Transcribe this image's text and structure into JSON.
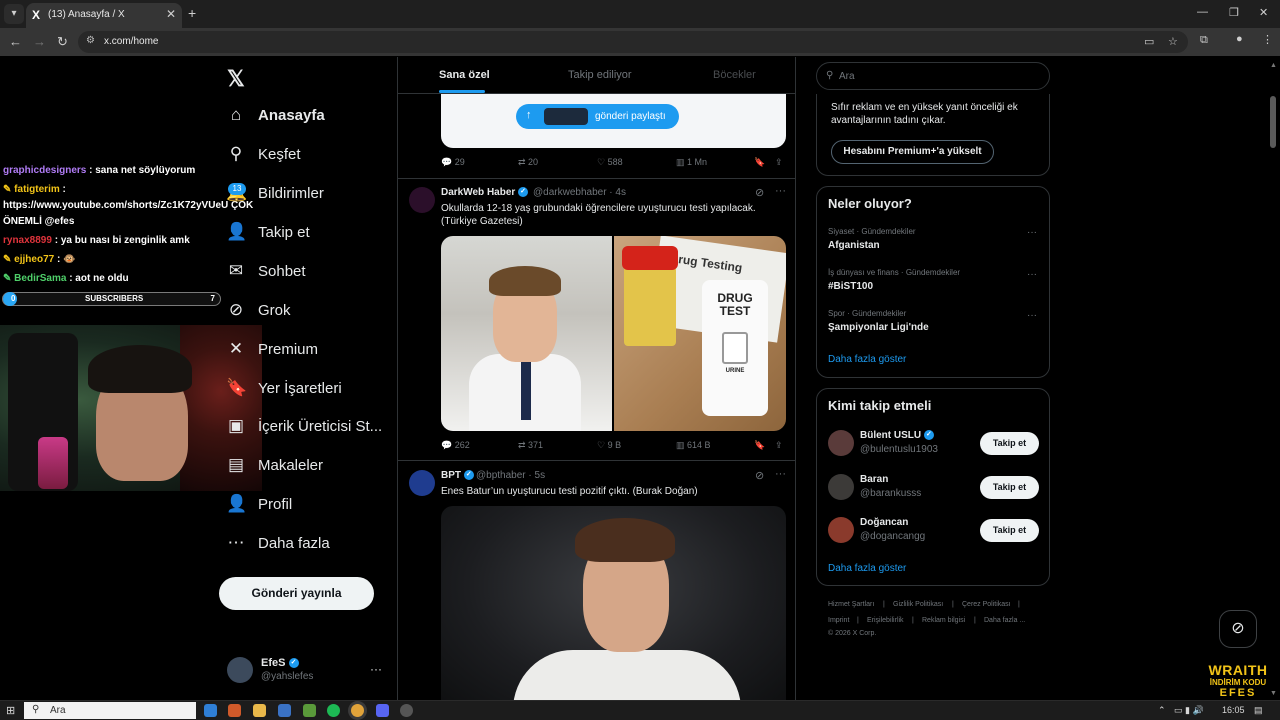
{
  "browser": {
    "tab_title": "(13) Anasayfa / X",
    "tab_favicon": "X",
    "url": "x.com/home"
  },
  "stream_overlay": {
    "chat": [
      {
        "user": "graphicdesigners",
        "message": " : sana net söylüyorum",
        "color": "#b07cf5"
      },
      {
        "user": "fatigterim",
        "message": " :",
        "color": "#f2c418"
      },
      {
        "user": "",
        "message": "https://www.youtube.com/shorts/Zc1K72yVUeU ÇOK",
        "color": "#ffffff"
      },
      {
        "user": "",
        "message": "ÖNEMLİ @efes",
        "color": "#ffffff"
      },
      {
        "user": "rynax8899",
        "message": " : ya bu nası bi zenginlik amk",
        "color": "#e0343c"
      },
      {
        "user": "ejjheo77",
        "message": " : 🐵",
        "color": "#f2c418"
      },
      {
        "user": "BedirSama",
        "message": " : aot ne oldu",
        "color": "#4fd06a"
      }
    ],
    "subscribers_label": "SUBSCRIBERS",
    "subscribers_current": "0",
    "subscribers_goal": "7",
    "brand_line1": "WRAITH",
    "brand_line2": "İNDİRİM KODU",
    "brand_line3": "EFES"
  },
  "x_nav": {
    "logo": "𝕏",
    "items": [
      {
        "label": "Anasayfa",
        "icon": "home-icon",
        "glyph": "⌂",
        "active": true
      },
      {
        "label": "Keşfet",
        "icon": "search-icon",
        "glyph": "⚲"
      },
      {
        "label": "Bildirimler",
        "icon": "bell-icon",
        "glyph": "🔔"
      },
      {
        "label": "Takip et",
        "icon": "person-add-icon",
        "glyph": "👤"
      },
      {
        "label": "Sohbet",
        "icon": "mail-icon",
        "glyph": "✉"
      },
      {
        "label": "Grok",
        "icon": "grok-icon",
        "glyph": "⊘"
      },
      {
        "label": "Premium",
        "icon": "premium-icon",
        "glyph": "✕"
      },
      {
        "label": "Yer İşaretleri",
        "icon": "bookmark-icon",
        "glyph": "🔖"
      },
      {
        "label": "İçerik Üreticisi St...",
        "icon": "creator-studio-icon",
        "glyph": "▣"
      },
      {
        "label": "Makaleler",
        "icon": "articles-icon",
        "glyph": "▤"
      },
      {
        "label": "Profil",
        "icon": "profile-icon",
        "glyph": "👤"
      },
      {
        "label": "Daha fazla",
        "icon": "more-circle-icon",
        "glyph": "⋯"
      }
    ],
    "notifications_badge": "13",
    "post_button": "Gönderi yayınla",
    "account": {
      "name": "EfeS",
      "handle": "@yahslefes"
    }
  },
  "timeline": {
    "tabs": [
      "Sana özel",
      "Takip ediliyor",
      "Böcekler"
    ],
    "top_post": {
      "share_pill": "gönderi paylaştı",
      "replies": "29",
      "reposts": "20",
      "likes": "588",
      "views": "1 Mn"
    },
    "posts": [
      {
        "author": "DarkWeb Haber",
        "handle": "@darkwebhaber",
        "time": "4s",
        "text": "Okullarda 12-18 yaş grubundaki öğrencilere uyuşturucu testi yapılacak. (Türkiye Gazetesi)",
        "image_left_alt": "schoolboy in classroom",
        "image_right_text": "Drug Testing",
        "kit_text": "DRUG TEST",
        "kit_label": "URINE",
        "replies": "262",
        "reposts": "371",
        "likes": "9 B",
        "views": "614 B"
      },
      {
        "author": "BPT",
        "handle": "@bpthaber",
        "time": "5s",
        "text": "Enes Batur’un uyuşturucu testi pozitif çıktı. (Burak Doğan)"
      }
    ]
  },
  "right": {
    "search_placeholder": "Ara",
    "premium_text": "Sıfır reklam ve en yüksek yanıt önceliği ek avantajlarının tadını çıkar.",
    "premium_button": "Hesabını Premium+'a yükselt",
    "trends_title": "Neler oluyor?",
    "trends": [
      {
        "category": "Siyaset · Gündemdekiler",
        "name": "Afganistan"
      },
      {
        "category": "İş dünyası ve finans · Gündemdekiler",
        "name": "#BiST100"
      },
      {
        "category": "Spor · Gündemdekiler",
        "name": "Şampiyonlar Ligi'nde"
      }
    ],
    "trends_more": "Daha fazla göster",
    "wtf_title": "Kimi takip etmeli",
    "wtf": [
      {
        "name": "Bülent USLU",
        "handle": "@bulentuslu1903",
        "verified": true,
        "button": "Takip et"
      },
      {
        "name": "Baran",
        "handle": "@barankusss",
        "verified": false,
        "button": "Takip et"
      },
      {
        "name": "Doğancan",
        "handle": "@dogancangg",
        "verified": false,
        "button": "Takip et"
      }
    ],
    "wtf_more": "Daha fazla göster",
    "footer_row1": [
      "Hizmet Şartları",
      "Gizlilik Politikası",
      "Çerez Politikası"
    ],
    "footer_row2": [
      "Imprint",
      "Erişilebilirlik",
      "Reklam bilgisi",
      "Daha fazla ..."
    ],
    "copyright": "© 2026 X Corp."
  },
  "taskbar": {
    "search_placeholder": "Ara",
    "time": "16:05"
  },
  "colors": {
    "accent": "#1d9bf0",
    "background": "#000000",
    "border": "#2f3336",
    "muted": "#71767b"
  }
}
